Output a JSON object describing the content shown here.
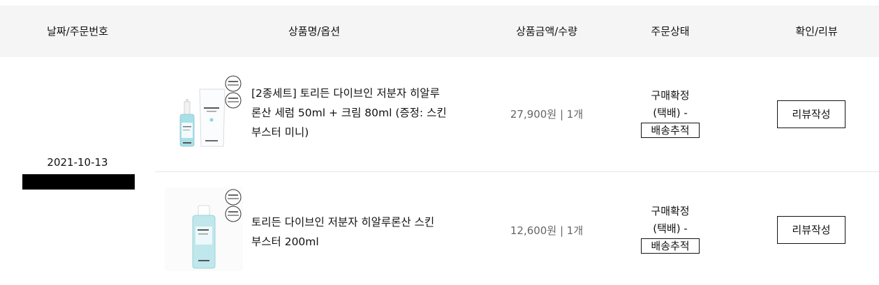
{
  "header": {
    "date_order": "날짜/주문번호",
    "product": "상품명/옵션",
    "price_qty": "상품금액/수량",
    "status": "주문상태",
    "review": "확인/리뷰"
  },
  "order": {
    "date": "2021-10-13"
  },
  "items": [
    {
      "thumb_icon": "serum-and-cream-set-image",
      "name_lines": [
        "[2종세트] 토리든 다이브인 저분자 히알루",
        "론산 세럼 50ml + 크림 80ml (증정: 스킨",
        "부스터 미니)"
      ],
      "price": "27,900원",
      "separator": "|",
      "qty": "1개",
      "status_lines": [
        "구매확정",
        "(택배) -"
      ],
      "track_label": "배송추적",
      "review_label": "리뷰작성"
    },
    {
      "thumb_icon": "skin-booster-bottle-image",
      "name_lines": [
        "토리든 다이브인 저분자 히알루론산 스킨",
        "부스터 200ml"
      ],
      "price": "12,600원",
      "separator": "|",
      "qty": "1개",
      "status_lines": [
        "구매확정",
        "(택배) -"
      ],
      "track_label": "배송추적",
      "review_label": "리뷰작성"
    }
  ],
  "colors": {
    "header_bg": "#f5f5f5",
    "text": "#111111",
    "price_text": "#666666",
    "product_blue": "#8fd3dc",
    "redacted": "#000000"
  }
}
